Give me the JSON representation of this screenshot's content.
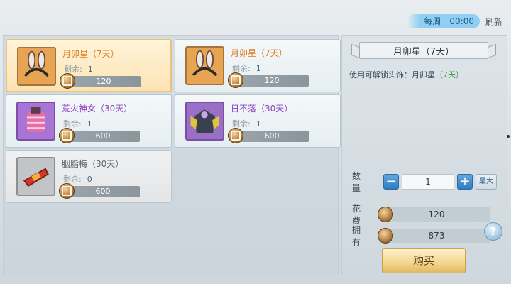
{
  "refresh": {
    "time_text": "每周一00:00",
    "refresh_label": "刷新"
  },
  "items": [
    {
      "name": "月卯星（7天）",
      "remain_label": "剩余:",
      "remain_value": "1",
      "price": "120",
      "color": "orange",
      "state": "selected"
    },
    {
      "name": "月卯星（7天）",
      "remain_label": "剩余:",
      "remain_value": "1",
      "price": "120",
      "color": "orange",
      "state": "normal"
    },
    {
      "name": "荒火神女（30天）",
      "remain_label": "剩余:",
      "remain_value": "1",
      "price": "600",
      "color": "purple",
      "state": "normal"
    },
    {
      "name": "日不落（30天）",
      "remain_label": "剩余:",
      "remain_value": "1",
      "price": "600",
      "color": "purple",
      "state": "normal"
    },
    {
      "name": "胭脂梅（30天）",
      "remain_label": "剩余:",
      "remain_value": "0",
      "price": "600",
      "color": "gray",
      "state": "dim"
    }
  ],
  "detail": {
    "title": "月卯星（7天）",
    "desc_prefix": "使用可解锁头饰：月卯星",
    "desc_duration": "（7天）",
    "qty_label": "数 量",
    "qty_minus": "−",
    "qty_value": "1",
    "qty_plus": "+",
    "qty_max": "最大",
    "cost_label": "花 费",
    "cost_value": "120",
    "own_label": "拥 有",
    "own_value": "873",
    "help": "?",
    "buy_label": "购买"
  },
  "colors": {
    "orange": "#e07a1f",
    "purple": "#8a3fc1",
    "gray": "#606468",
    "green": "#3a9a3a",
    "accent_blue": "#2f7dc0"
  }
}
